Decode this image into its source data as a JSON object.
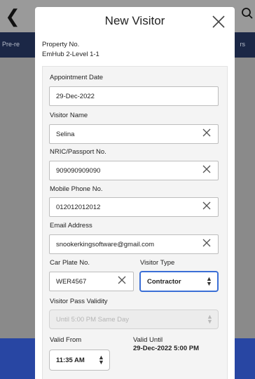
{
  "background": {
    "back_icon": "chevron-left-icon",
    "search_icon": "search-icon",
    "tab_left_label": "Pre-re",
    "tab_right_label": "rs"
  },
  "modal": {
    "title": "New Visitor",
    "close_icon": "close-icon",
    "property_label": "Property No.",
    "property_value": "EmHub 2-Level 1-1"
  },
  "form": {
    "appointment_date": {
      "label": "Appointment Date",
      "value": "29-Dec-2022"
    },
    "visitor_name": {
      "label": "Visitor Name",
      "value": "Selina"
    },
    "nric": {
      "label": "NRIC/Passport No.",
      "value": "909090909090"
    },
    "mobile": {
      "label": "Mobile Phone No.",
      "value": "012012012012"
    },
    "email": {
      "label": "Email Address",
      "value": "snookerkingsoftware@gmail.com"
    },
    "car_plate": {
      "label": "Car Plate No.",
      "value": "WER4567"
    },
    "visitor_type": {
      "label": "Visitor Type",
      "value": "Contractor"
    },
    "pass_validity": {
      "label": "Visitor Pass Validity",
      "value": "Until 5:00 PM Same Day"
    },
    "valid_from": {
      "label": "Valid From",
      "value": "11:35 AM"
    },
    "valid_until": {
      "label": "Valid Until",
      "value": "29-Dec-2022 5:00 PM"
    }
  },
  "colors": {
    "accent_focus": "#3b6fd6",
    "tab_bar": "#1b2746",
    "bottom_bar": "#2846a3"
  }
}
